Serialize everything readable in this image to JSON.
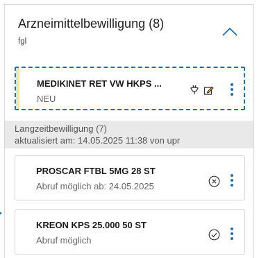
{
  "panel": {
    "title": "Arzneimittelbewilligung (8)",
    "subtitle": "fgl"
  },
  "selected_card": {
    "name": "MEDIKINET RET VW HKPS ...",
    "status": "NEU"
  },
  "group": {
    "title": "Langzeitbewilligung (7)",
    "updated": "aktualisiert am: 14.05.2025 11:38 von upr"
  },
  "items": [
    {
      "name": "PROSCAR FTBL 5MG 28 ST",
      "status": "Abruf möglich ab: 24.05.2025",
      "icon": "x-circle-icon"
    },
    {
      "name": "KREON KPS 25.000 50 ST",
      "status": "Abruf möglich",
      "icon": "check-circle-icon"
    }
  ],
  "colors": {
    "accent": "#1f6fb5",
    "selected_stripe": "#f3e7a0",
    "group_bg": "#e9e9e9"
  }
}
